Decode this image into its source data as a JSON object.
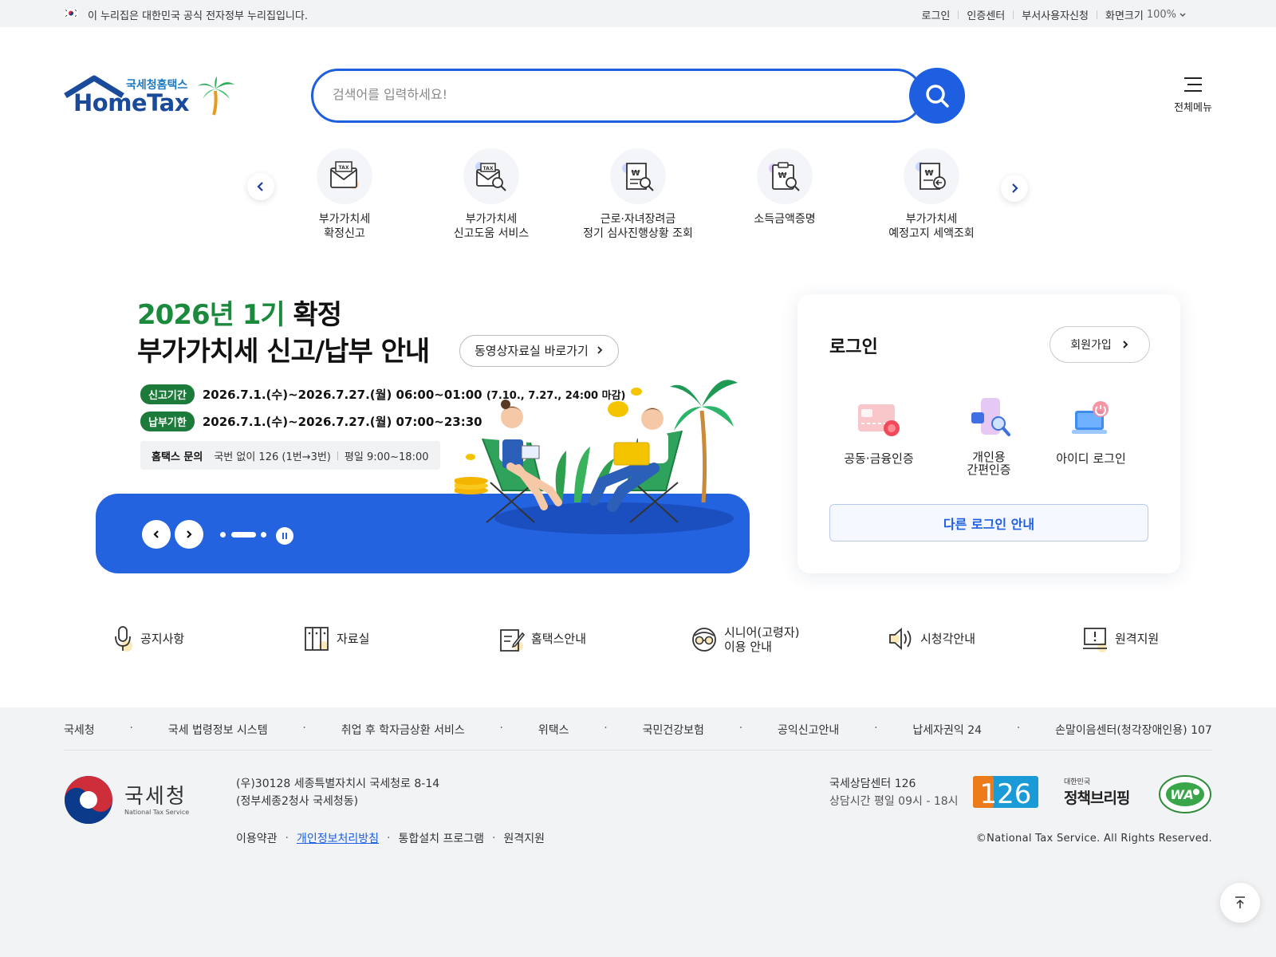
{
  "gov_bar": {
    "text": "이 누리집은 대한민국 공식 전자정부 누리집입니다.",
    "links": [
      "로그인",
      "인증센터",
      "부서사용자신청",
      "화면크기"
    ],
    "zoom_level": "100%"
  },
  "logo": {
    "small_text": "국세청홈택스",
    "big_text": "HomeTax"
  },
  "search": {
    "placeholder": "검색어를 입력하세요!"
  },
  "all_menu": {
    "label": "전체메뉴"
  },
  "quick_menu": [
    {
      "label": "부가가치세\n확정신고",
      "icon": "tax-envelope-icon"
    },
    {
      "label": "부가가치세\n신고도움 서비스",
      "icon": "tax-search-icon"
    },
    {
      "label": "근로·자녀장려금\n정기 심사진행상황 조회",
      "icon": "won-receipt-search-icon"
    },
    {
      "label": "소득금액증명",
      "icon": "won-clipboard-search-icon"
    },
    {
      "label": "부가가치세\n예정고지 세액조회",
      "icon": "won-receipt-arrow-icon"
    }
  ],
  "banner": {
    "title_highlight": "2026년 1기",
    "title_rest": " 확정",
    "title_line2": "부가가치세 신고/납부 안내",
    "video_button": "동영상자료실 바로가기",
    "report_tag": "신고기간",
    "report_period": "2026.7.1.(수)~2026.7.27.(월) 06:00~01:00",
    "report_note": "(7.10., 7.27., 24:00 마감)",
    "pay_tag": "납부기한",
    "pay_period": "2026.7.1.(수)~2026.7.27.(월) 07:00~23:30",
    "inquiry_label": "홈택스 문의",
    "inquiry_phone": "국번 없이 126 (1번→3번)",
    "inquiry_hours": "평일 9:00~18:00"
  },
  "login": {
    "title": "로그인",
    "join_button": "회원가입",
    "options": [
      {
        "label": "공동·금융인증",
        "icon": "certificate-card-icon"
      },
      {
        "label": "개인용\n간편인증",
        "icon": "phone-search-icon"
      },
      {
        "label": "아이디 로그인",
        "icon": "laptop-power-icon"
      }
    ],
    "other_button": "다른 로그인 안내"
  },
  "services": [
    {
      "label": "공지사항",
      "icon": "microphone-icon"
    },
    {
      "label": "자료실",
      "icon": "archive-icon"
    },
    {
      "label": "홈택스안내",
      "icon": "edit-document-icon"
    },
    {
      "label": "시니어(고령자)\n이용 안내",
      "icon": "senior-glasses-icon"
    },
    {
      "label": "시청각안내",
      "icon": "speaker-icon"
    },
    {
      "label": "원격지원",
      "icon": "monitor-alert-icon"
    }
  ],
  "footer": {
    "links": [
      "국세청",
      "국세 법령정보 시스템",
      "취업 후 학자금상환 서비스",
      "위택스",
      "국민건강보험",
      "공익신고안내",
      "납세자권익 24",
      "손말이음센터(청각장애인용) 107"
    ],
    "org_name": "국세청",
    "org_eng": "National Tax Service",
    "address": "(우)30128 세종특별자치시 국세청로 8-14\n(정부세종2청사 국세청동)",
    "bottom_links": [
      "이용약관",
      "개인정보처리방침",
      "통합설치 프로그램",
      "원격지원"
    ],
    "center_name": "국세상담센터 126",
    "center_hours": "상담시간 평일 09시 - 18시",
    "badge_126": "126",
    "policy_top": "대한민국",
    "policy_main": "정책브리핑",
    "wa_text": "WA",
    "copyright": "©National Tax Service. All Rights Reserved."
  },
  "colors": {
    "primary": "#1d5fe0",
    "green": "#1c8a3c",
    "banner_blue": "#2463e0"
  }
}
